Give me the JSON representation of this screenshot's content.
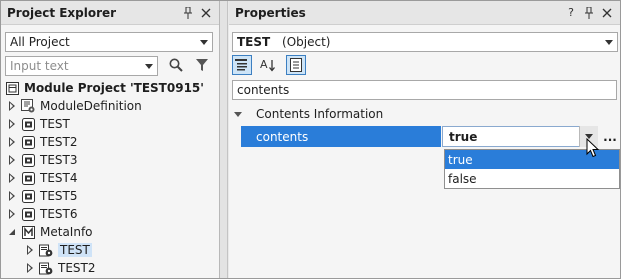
{
  "explorer": {
    "title": "Project Explorer",
    "filter_value": "All Project",
    "search_placeholder": "Input text",
    "tree": [
      {
        "label": "Module Project 'TEST0915'",
        "icon": "project-icon",
        "bold": true,
        "level": 0,
        "expander": "none"
      },
      {
        "label": "ModuleDefinition",
        "icon": "module-definition-icon",
        "level": 1,
        "expander": "collapsed"
      },
      {
        "label": "TEST",
        "icon": "object-icon",
        "level": 1,
        "expander": "collapsed"
      },
      {
        "label": "TEST2",
        "icon": "object-icon",
        "level": 1,
        "expander": "collapsed"
      },
      {
        "label": "TEST3",
        "icon": "object-icon",
        "level": 1,
        "expander": "collapsed"
      },
      {
        "label": "TEST4",
        "icon": "object-icon",
        "level": 1,
        "expander": "collapsed"
      },
      {
        "label": "TEST5",
        "icon": "object-icon",
        "level": 1,
        "expander": "collapsed"
      },
      {
        "label": "TEST6",
        "icon": "object-icon",
        "level": 1,
        "expander": "collapsed"
      },
      {
        "label": "MetaInfo",
        "icon": "meta-icon",
        "level": 1,
        "expander": "expanded"
      },
      {
        "label": "TEST",
        "icon": "metadata-icon",
        "level": 2,
        "expander": "collapsed",
        "selected": true
      },
      {
        "label": "TEST2",
        "icon": "metadata-icon",
        "level": 2,
        "expander": "collapsed"
      }
    ]
  },
  "properties": {
    "title": "Properties",
    "object_name": "TEST",
    "object_type": "(Object)",
    "search_value": "contents",
    "category": "Contents Information",
    "property_name": "contents",
    "property_value": "true",
    "options": [
      "true",
      "false"
    ],
    "ellipsis": "..."
  },
  "titlebar_glyphs": {
    "help": "?",
    "pin": "↓",
    "close": "✕"
  },
  "colors": {
    "accent": "#2a7dd9",
    "selected_tree": "#cfe3f7"
  }
}
